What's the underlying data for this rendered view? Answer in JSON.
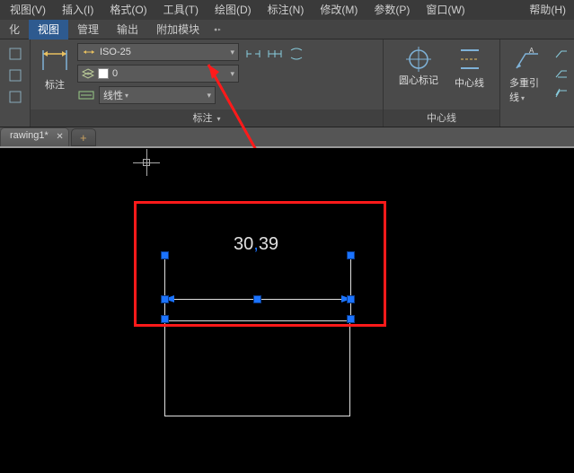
{
  "menu": {
    "items": [
      "视图(V)",
      "插入(I)",
      "格式(O)",
      "工具(T)",
      "绘图(D)",
      "标注(N)",
      "修改(M)",
      "参数(P)",
      "窗口(W)",
      "帮助(H)"
    ]
  },
  "ribbonTabs": {
    "items": [
      "化",
      "视图",
      "管理",
      "输出",
      "附加模块"
    ],
    "activeIndex": 1
  },
  "panels": {
    "annotate": {
      "title": "标注",
      "bigButtonLabel": "标注",
      "styleDropdown": "ISO-25",
      "layerDropdown": "0",
      "linetypeLabel": "线性",
      "panelCaret": "▾",
      "smallIconStrip": [
        "dim-break-icon",
        "dim-continue-icon",
        "dim-baseline-icon"
      ]
    },
    "centerline": {
      "title": "中心线",
      "circleCenterLabel": "圆心标记",
      "centerlineLabel": "中心线"
    },
    "leader": {
      "label": "多重引线",
      "caret": "▾"
    }
  },
  "docTabs": {
    "items": [
      "rawing1*"
    ],
    "add": "+"
  },
  "canvas": {
    "dimensionValue": "30,39"
  }
}
